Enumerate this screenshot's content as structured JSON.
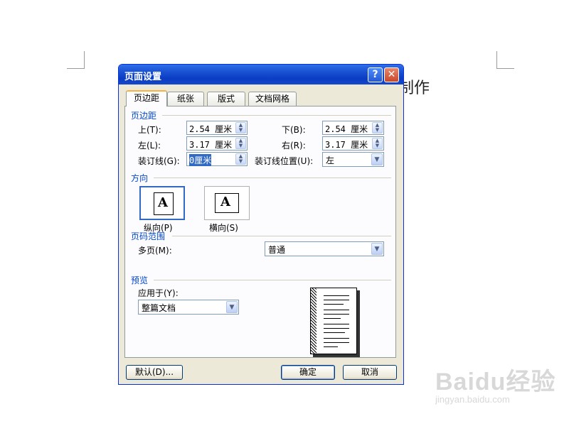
{
  "document": {
    "visible_text": "制作"
  },
  "watermark": {
    "logo": "Baidu经验",
    "site": "jingyan.baidu.com"
  },
  "dialog": {
    "title": "页面设置",
    "help_glyph": "?",
    "close_glyph": "✕",
    "tabs": [
      {
        "label": "页边距",
        "active": true
      },
      {
        "label": "纸张",
        "active": false
      },
      {
        "label": "版式",
        "active": false
      },
      {
        "label": "文档网格",
        "active": false
      }
    ],
    "margins": {
      "group_title": "页边距",
      "top_label": "上(T):",
      "top_value": "2.54 厘米",
      "bottom_label": "下(B):",
      "bottom_value": "2.54 厘米",
      "left_label": "左(L):",
      "left_value": "3.17 厘米",
      "right_label": "右(R):",
      "right_value": "3.17 厘米",
      "gutter_label": "装订线(G):",
      "gutter_value": "0厘米",
      "gutter_pos_label": "装订线位置(U):",
      "gutter_pos_value": "左"
    },
    "orientation": {
      "group_title": "方向",
      "icon_letter": "A",
      "portrait_label": "纵向(P)",
      "landscape_label": "横向(S)",
      "selected": "portrait"
    },
    "pages": {
      "group_title": "页码范围",
      "multi_label": "多页(M):",
      "multi_value": "普通"
    },
    "preview": {
      "group_title": "预览",
      "apply_label": "应用于(Y):",
      "apply_value": "整篇文档"
    },
    "buttons": {
      "default_label": "默认(D)...",
      "ok_label": "确定",
      "cancel_label": "取消"
    },
    "icons": {
      "spin": "spin-arrows-icon",
      "dropdown": "chevron-down-icon"
    }
  }
}
